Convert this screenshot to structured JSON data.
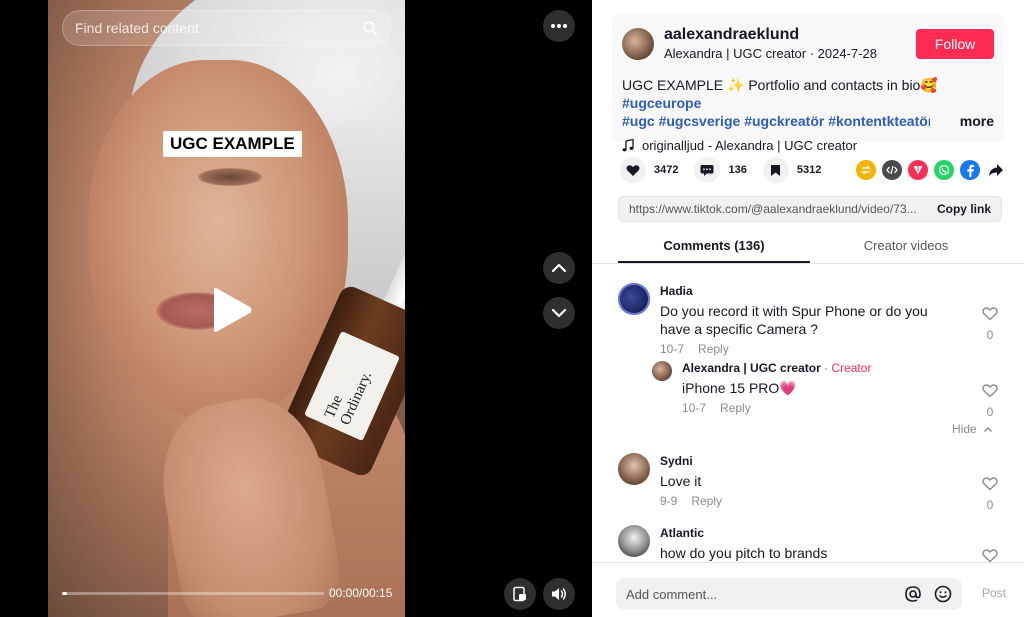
{
  "video": {
    "search_placeholder": "Find related content",
    "caption_sticker": "UGC EXAMPLE",
    "bottle_brand": "The Ordinary.",
    "time": "00:00/00:15",
    "progress": 0.02
  },
  "author": {
    "handle": "aalexandraeklund",
    "subtitle": "Alexandra | UGC creator · 2024-7-28",
    "follow_label": "Follow"
  },
  "description": {
    "text": "UGC EXAMPLE ✨ Portfolio and contacts in bio🥰 ",
    "tags": [
      "#ugceurope",
      "#ugc",
      "#ugcsverige",
      "#ugckreatör",
      "#kontentkteatör..."
    ],
    "more_label": "more",
    "music": "originalljud - Alexandra | UGC creator"
  },
  "stats": {
    "likes": "3472",
    "comments": "136",
    "saves": "5312"
  },
  "share": {
    "link": "https://www.tiktok.com/@aalexandraeklund/video/73...",
    "copy_label": "Copy link",
    "colors": {
      "repost": "#f5b400",
      "embed": "#4a4a4a",
      "send": "#fe2c55",
      "whatsapp": "#25d366",
      "facebook": "#1877f2"
    }
  },
  "tabs": {
    "comments": "Comments (136)",
    "creator_videos": "Creator videos"
  },
  "comments": [
    {
      "name": "Hadia",
      "text": "Do you record it with Spur Phone or do you have a specific Camera ?",
      "date": "10-7",
      "reply": "Reply",
      "likes": "0"
    },
    {
      "name": "Alexandra | UGC creator",
      "creator_tag": "· Creator",
      "text": "iPhone 15 PRO💗",
      "date": "10-7",
      "reply": "Reply",
      "likes": "0"
    },
    {
      "name": "Sydni",
      "text": "Love it",
      "date": "9-9",
      "reply": "Reply",
      "likes": "0"
    },
    {
      "name": "Atlantic",
      "text": "how do you pitch to brands",
      "date": "",
      "reply": "",
      "likes": ""
    }
  ],
  "hide_label": "Hide",
  "comment_bar": {
    "placeholder": "Add comment...",
    "post_label": "Post"
  }
}
